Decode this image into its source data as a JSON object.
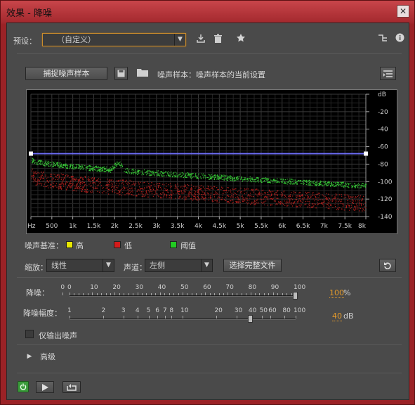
{
  "window": {
    "title": "效果 - 降噪",
    "close": "✕"
  },
  "preset": {
    "label": "预设：",
    "value": "（自定义）"
  },
  "capture_button": "捕捉噪声样本",
  "noise_sample_text": "噪声样本：噪声样本的当前设置",
  "graph": {
    "y_ticks": [
      "dB",
      "-20",
      "-40",
      "-60",
      "-80",
      "-100",
      "-120",
      "-140"
    ],
    "x_ticks": [
      "Hz",
      "500",
      "1k",
      "1.5k",
      "2k",
      "2.5k",
      "3k",
      "3.5k",
      "4k",
      "4.5k",
      "5k",
      "5.5k",
      "6k",
      "6.5k",
      "7k",
      "7.5k",
      "8k"
    ]
  },
  "legend": {
    "label": "噪声基准：",
    "items": [
      {
        "name": "高",
        "color": "#e8e800"
      },
      {
        "name": "低",
        "color": "#d41a1a"
      },
      {
        "name": "阈值",
        "color": "#22cc22"
      }
    ]
  },
  "scale": {
    "label": "缩放：",
    "value": "线性"
  },
  "channel": {
    "label": "声道：",
    "value": "左侧"
  },
  "select_file_button": "选择完整文件",
  "noise_reduction": {
    "label": "降噪：",
    "ticks": [
      "0",
      "0",
      "10",
      "20",
      "30",
      "40",
      "50",
      "60",
      "70",
      "80",
      "90",
      "100"
    ],
    "value": "100",
    "unit": "%",
    "level": 1.0
  },
  "reduction_amount": {
    "label": "降噪幅度：",
    "ticks": [
      "1",
      "2",
      "3",
      "4",
      "5",
      "6",
      "7",
      "8",
      "10",
      "20",
      "30",
      "40",
      "50",
      "60",
      "80",
      "100"
    ],
    "value": "40",
    "unit": "dB",
    "level": 0.8
  },
  "output_noise_only": "仅输出噪声",
  "advanced": "高级"
}
